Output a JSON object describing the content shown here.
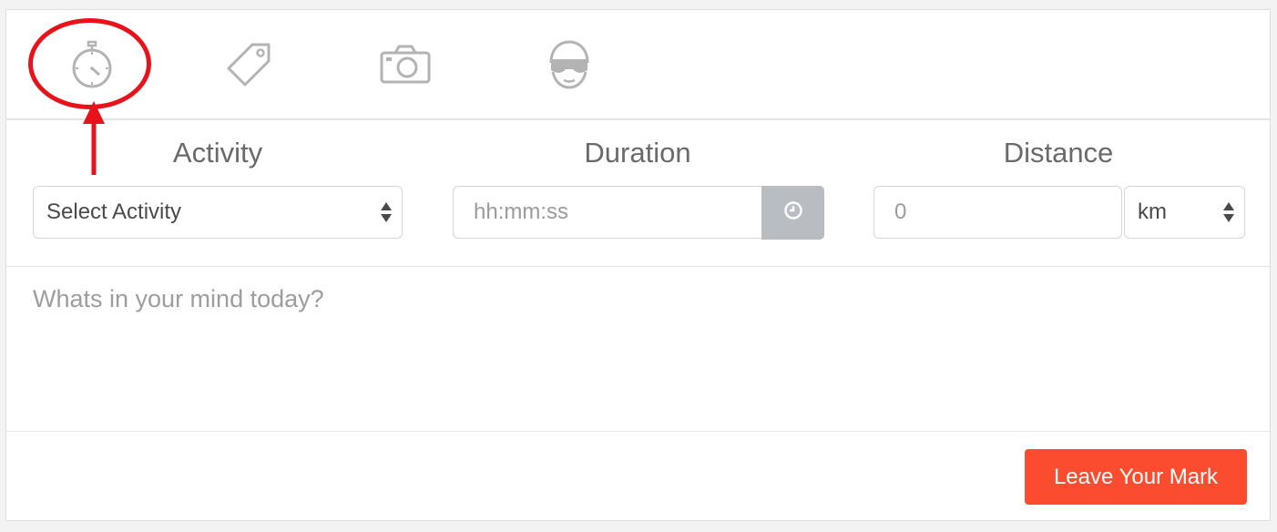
{
  "tabs": [
    {
      "icon": "stopwatch-icon",
      "active": true
    },
    {
      "icon": "tag-icon",
      "active": false
    },
    {
      "icon": "camera-icon",
      "active": false
    },
    {
      "icon": "athlete-goggles-icon",
      "active": false
    }
  ],
  "fields": {
    "activity": {
      "label": "Activity",
      "selected": "Select Activity"
    },
    "duration": {
      "label": "Duration",
      "placeholder": "hh:mm:ss",
      "button_icon": "clock-icon"
    },
    "distance": {
      "label": "Distance",
      "value_placeholder": "0",
      "unit_selected": "km"
    }
  },
  "message": {
    "placeholder": "Whats in your mind today?"
  },
  "submit": {
    "label": "Leave Your Mark"
  },
  "colors": {
    "accent": "#fc4c2f",
    "icon_gray": "#b3b3b3",
    "annotation_red": "#e8121b",
    "clock_button": "#b9bdc1"
  }
}
